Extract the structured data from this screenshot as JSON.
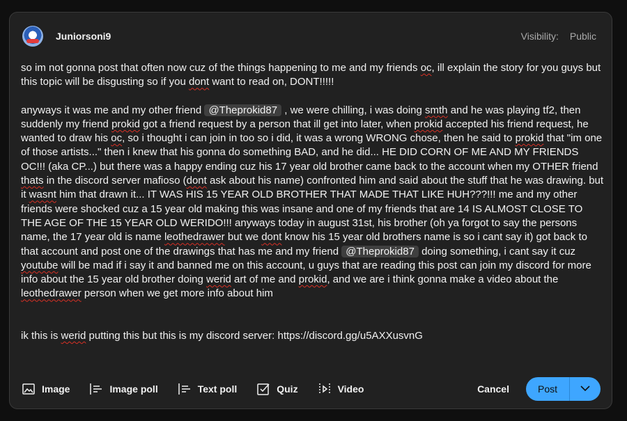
{
  "header": {
    "channel_name": "Juniorsoni9",
    "visibility_label": "Visibility:",
    "visibility_value": "Public"
  },
  "post": {
    "intro": [
      {
        "t": "so im not gonna post that often now cuz of the things happening to me and my friends "
      },
      {
        "t": "oc",
        "sp": true
      },
      {
        "t": ", ill explain the story for you guys but this topic will be disgusting so if you "
      },
      {
        "t": "dont",
        "sp": true
      },
      {
        "t": " want to read on, DONT!!!!!"
      }
    ],
    "story": [
      {
        "t": "anyways it was me and my other friend "
      },
      {
        "t": "@Theprokid87",
        "mention": true
      },
      {
        "t": " , we were chilling, i was doing "
      },
      {
        "t": "smth",
        "sp": true
      },
      {
        "t": " and he was playing tf2, then suddenly my friend "
      },
      {
        "t": "prokid",
        "sp": true
      },
      {
        "t": " got a friend request by a person that ill get into later, when "
      },
      {
        "t": "prokid",
        "sp": true
      },
      {
        "t": " accepted his friend request, he wanted to draw his "
      },
      {
        "t": "oc",
        "sp": true
      },
      {
        "t": ", so i thought i can join in too so i did, it was a wrong WRONG chose, then he said to "
      },
      {
        "t": "prokid",
        "sp": true
      },
      {
        "t": " that \"im one of those artists...\" then i knew that his gonna do something BAD, and he did... HE DID CORN OF ME AND MY FRIENDS OC!!! (aka CP...) but there was a happy ending cuz his 17 year old brother came back to the account when my OTHER friend "
      },
      {
        "t": "thats",
        "sp": true
      },
      {
        "t": " in the discord server mafioso ("
      },
      {
        "t": "dont",
        "sp": true
      },
      {
        "t": " ask about his name) confronted him and said about the stuff that he was drawing. but it "
      },
      {
        "t": "wasnt",
        "sp": true
      },
      {
        "t": " him that drawn it... IT WAS HIS 15 YEAR OLD BROTHER THAT MADE THAT LIKE HUH???!!! me and my other friends were shocked cuz a 15 year old making this was insane and one of my friends that are 14 IS ALMOST CLOSE TO THE AGE OF THE 15 YEAR OLD WERIDO!!! anyways today in august 31st, his brother (oh ya forgot to say the persons name, the 17 year old is name "
      },
      {
        "t": "leothedrawer",
        "sp": true
      },
      {
        "t": " but we "
      },
      {
        "t": "dont",
        "sp": true
      },
      {
        "t": " know his 15 year old brothers name is so i cant say it) got back to that account and post one of the drawings that has me and my friend "
      },
      {
        "t": "@Theprokid87",
        "mention": true
      },
      {
        "t": " doing something, i cant say it cuz "
      },
      {
        "t": "youtube",
        "sp": true
      },
      {
        "t": " will be mad if i say it and banned me on this account, u guys that are reading this post can join my discord for more info about the 15 year old brother doing "
      },
      {
        "t": "werid",
        "sp": true
      },
      {
        "t": " art of me and "
      },
      {
        "t": "prokid",
        "sp": true
      },
      {
        "t": ", and we are i think gonna make a video about the "
      },
      {
        "t": "leothedrawer",
        "sp": true
      },
      {
        "t": " person when we get more info about him"
      }
    ],
    "footer_line": [
      {
        "t": "ik this is "
      },
      {
        "t": "werid",
        "sp": true
      },
      {
        "t": " putting this but this is my discord server: https://discord.gg/u5AXXusvnG"
      }
    ]
  },
  "toolbar": {
    "image_label": "Image",
    "image_poll_label": "Image poll",
    "text_poll_label": "Text poll",
    "quiz_label": "Quiz",
    "video_label": "Video",
    "cancel_label": "Cancel",
    "post_label": "Post"
  },
  "colors": {
    "accent": "#3ea6ff",
    "card_bg": "#212121",
    "page_bg": "#0f0f0f",
    "mention_bg": "#3f3f3f",
    "spellcheck": "#d93025"
  }
}
